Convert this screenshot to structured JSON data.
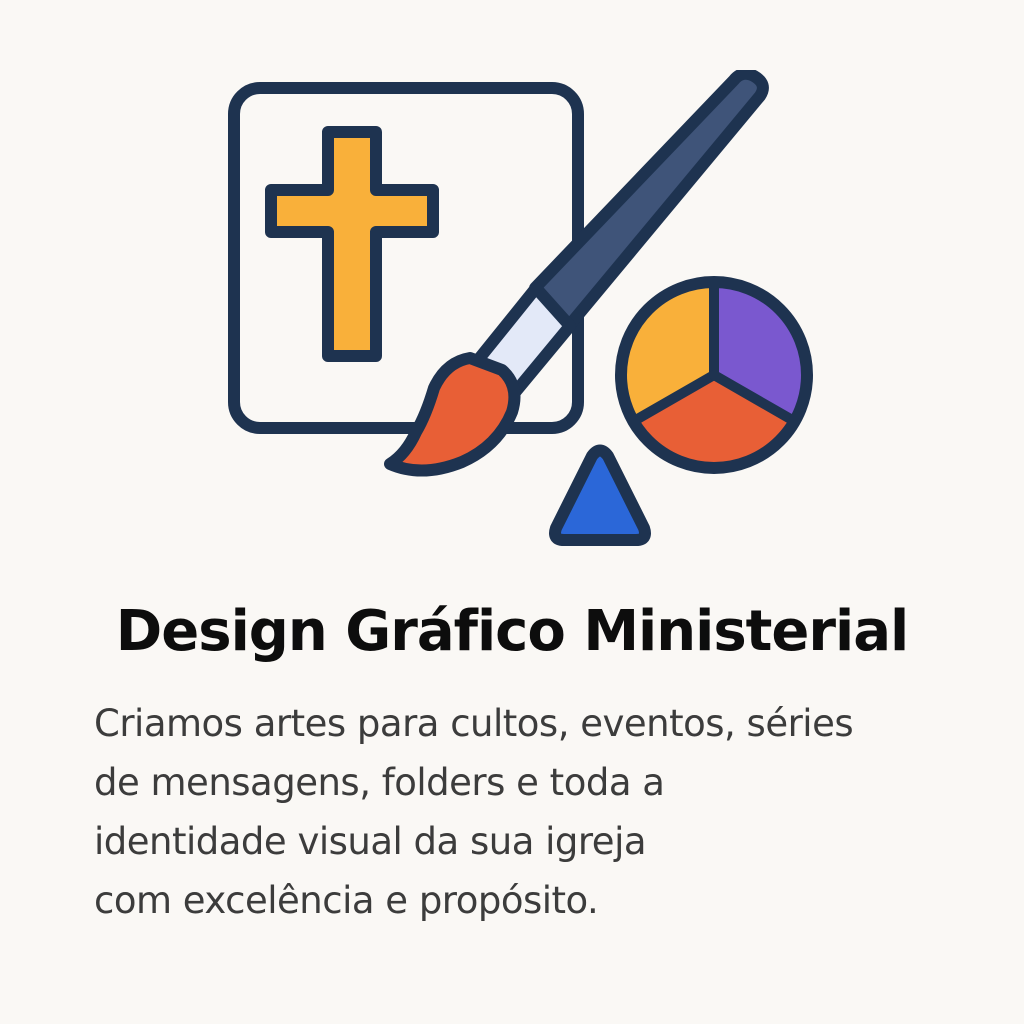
{
  "colors": {
    "background": "#faf8f5",
    "outline": "#1e3350",
    "cross": "#f9b03a",
    "brush_handle": "#3f5479",
    "brush_ferrule": "#e3e9f8",
    "brush_tip": "#e85f36",
    "wheel_yellow": "#f9b03a",
    "wheel_purple": "#7a58cf",
    "wheel_orange": "#e85f36",
    "triangle": "#2b67d8",
    "title_text": "#0d0d0d",
    "body_text": "#3c3c3c"
  },
  "illustration": {
    "icons": [
      "frame-icon",
      "cross-icon",
      "paintbrush-icon",
      "color-wheel-icon",
      "triangle-icon"
    ]
  },
  "title": "Design Gráfico Ministerial",
  "description": {
    "lines": [
      "Criamos artes para cultos, eventos, séries",
      "de mensagens, folders e toda a",
      "identidade visual da sua igreja",
      "com excelência e propósito."
    ]
  }
}
